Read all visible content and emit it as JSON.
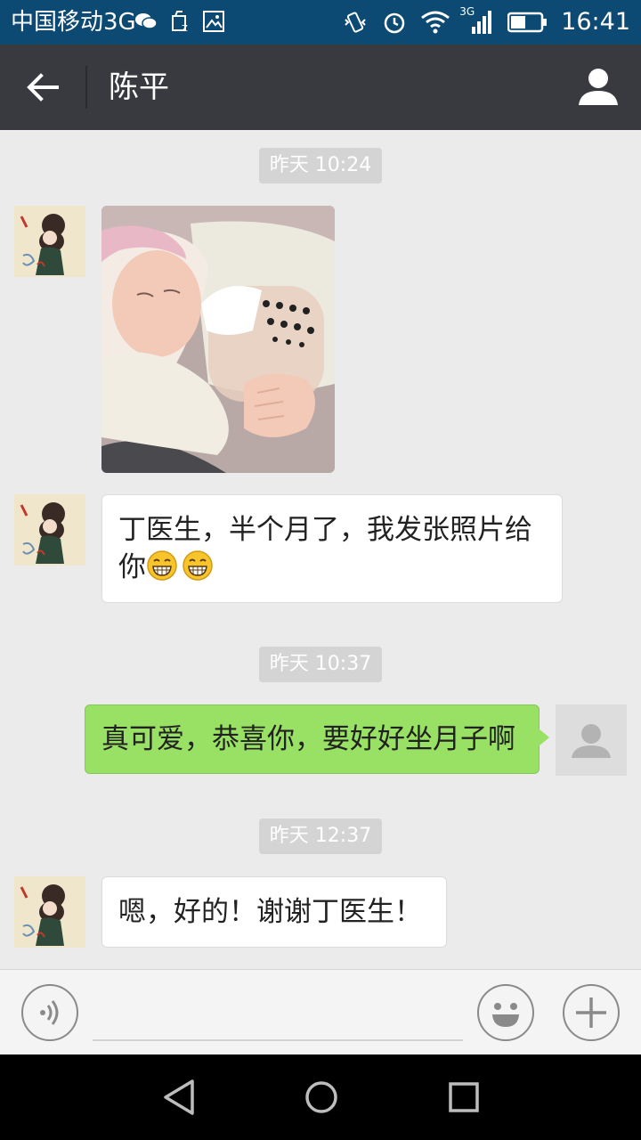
{
  "status_bar": {
    "carrier": "中国移动3G",
    "network_type": "3G",
    "time": "16:41",
    "icons": [
      "wechat-icon",
      "clean-icon",
      "image-icon",
      "vibrate-icon",
      "alarm-icon",
      "wifi-icon",
      "signal-icon",
      "battery-icon"
    ]
  },
  "header": {
    "title": "陈平",
    "back_icon": "arrow-left-icon",
    "profile_icon": "person-icon"
  },
  "messages": [
    {
      "type": "timestamp",
      "text": "昨天 10:24"
    },
    {
      "type": "image",
      "direction": "incoming",
      "description_icon": "baby-photo"
    },
    {
      "type": "text",
      "direction": "incoming",
      "text": "丁医生，半个月了，我发张照片给你"
    },
    {
      "type": "timestamp",
      "text": "昨天 10:37"
    },
    {
      "type": "text",
      "direction": "outgoing",
      "text": "真可爱，恭喜你，要好好坐月子啊"
    },
    {
      "type": "timestamp",
      "text": "昨天 12:37"
    },
    {
      "type": "text",
      "direction": "incoming",
      "text": "嗯，好的！谢谢丁医生！"
    }
  ],
  "input_bar": {
    "placeholder": "",
    "voice_icon": "voice-icon",
    "emoji_icon": "emoji-icon",
    "plus_icon": "plus-icon"
  },
  "colors": {
    "status_bar": "#0c4a73",
    "title_bar": "#393a3f",
    "chat_bg": "#ebebeb",
    "outgoing_bubble": "#98e165",
    "incoming_bubble": "#ffffff"
  }
}
